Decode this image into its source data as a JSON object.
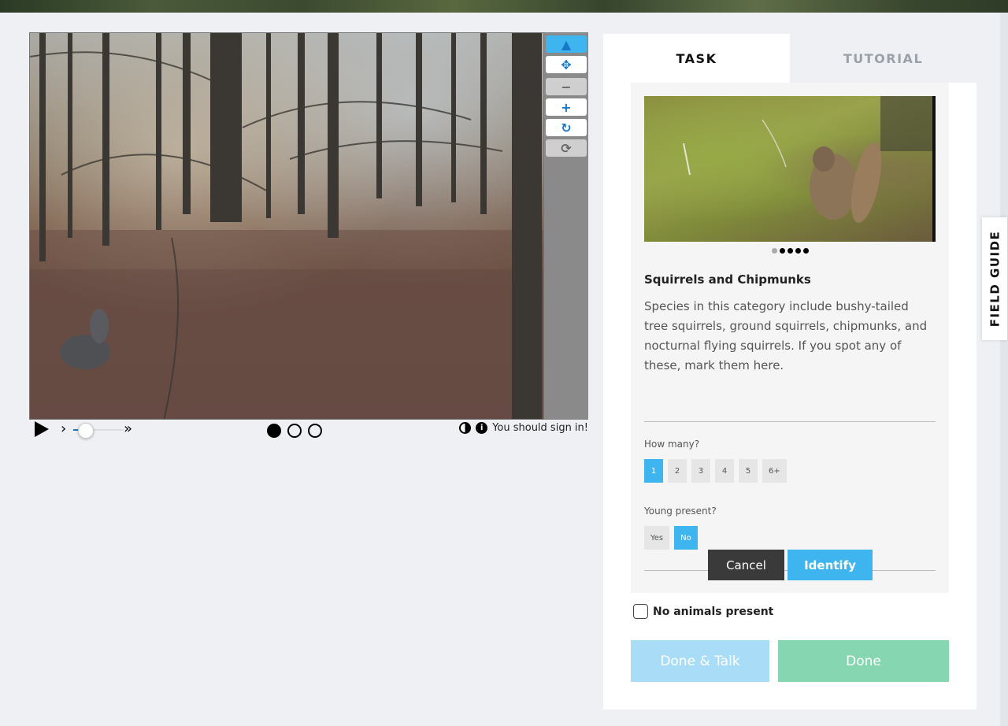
{
  "viewer": {
    "tools": [
      {
        "name": "pointer",
        "icon": "▲",
        "state": "active"
      },
      {
        "name": "pan",
        "icon": "✥",
        "state": "on"
      },
      {
        "name": "zoom-out",
        "icon": "−",
        "state": "off"
      },
      {
        "name": "zoom-in",
        "icon": "+",
        "state": "on"
      },
      {
        "name": "rotate",
        "icon": "↻",
        "state": "on"
      },
      {
        "name": "reset",
        "icon": "⟳",
        "state": "off"
      }
    ],
    "step_icon": "›",
    "ff_icon": "»",
    "speed_fraction": 0.25,
    "frame_count": 3,
    "current_frame": 1,
    "invert_icon": "contrast-icon",
    "info_icon": "i",
    "sign_in_text": "You should sign in!"
  },
  "tabs": {
    "task": "TASK",
    "tutorial": "TUTORIAL"
  },
  "species": {
    "carousel_total": 5,
    "carousel_current": 1,
    "title": "Squirrels and Chipmunks",
    "description": "Species in this category include bushy-tailed tree squirrels, ground squirrels, chipmunks, and nocturnal flying squirrels. If you spot any of these, mark them here."
  },
  "questions": {
    "how_many": {
      "label": "How many?",
      "options": [
        "1",
        "2",
        "3",
        "4",
        "5",
        "6+"
      ],
      "selected": "1"
    },
    "young_present": {
      "label": "Young present?",
      "options": [
        "Yes",
        "No"
      ],
      "selected": "No"
    }
  },
  "actions": {
    "cancel": "Cancel",
    "identify": "Identify",
    "no_animals": "No animals present",
    "done_talk": "Done & Talk",
    "done": "Done"
  },
  "field_guide": "FIELD GUIDE",
  "colors": {
    "accent": "#3eb5ee",
    "done": "#86d6b2",
    "done_talk": "#a8dcf7",
    "cancel": "#3a3a3a"
  }
}
